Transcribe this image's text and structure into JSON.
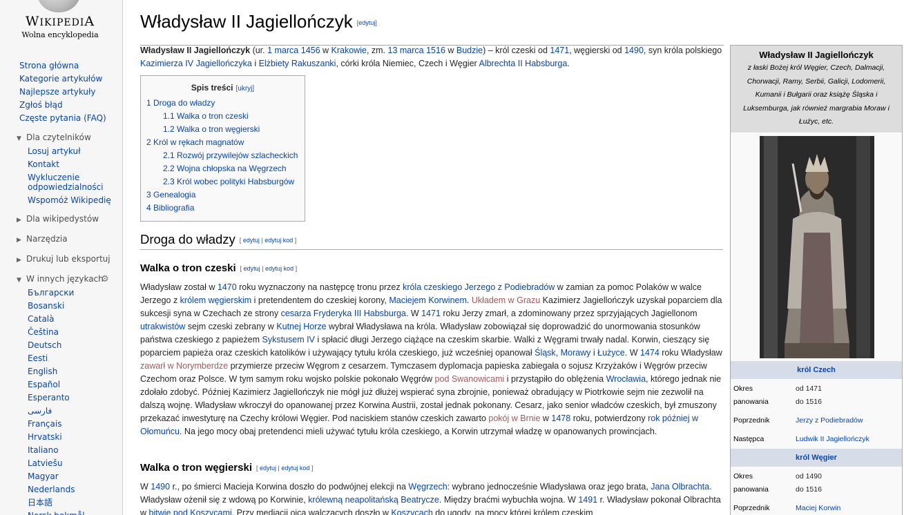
{
  "logo": {
    "wordmark": "Wikipedia",
    "tagline": "Wolna encyklopedia"
  },
  "nav": [
    "Strona główna",
    "Kategorie artykułów",
    "Najlepsze artykuły",
    "Zgłoś błąd",
    "Częste pytania (FAQ)"
  ],
  "portlets": {
    "readers": {
      "heading": "Dla czytelników",
      "items": [
        "Losuj artykuł",
        "Kontakt",
        "Wykluczenie odpowiedzialności",
        "Wspomóż Wikipedię"
      ]
    },
    "editors": {
      "heading": "Dla wikipedystów"
    },
    "tools": {
      "heading": "Narzędzia"
    },
    "print": {
      "heading": "Drukuj lub eksportuj"
    },
    "languages": {
      "heading": "W innych językach",
      "items": [
        "Български",
        "Bosanski",
        "Català",
        "Čeština",
        "Deutsch",
        "Eesti",
        "English",
        "Español",
        "Esperanto",
        "فارسی",
        "Français",
        "Hrvatski",
        "Italiano",
        "Latviešu",
        "Magyar",
        "Nederlands",
        "日本語",
        "Norsk bokmål"
      ]
    }
  },
  "article": {
    "title": "Władysław II Jagiellończyk",
    "edit": "edytuj",
    "edit_source": "edytuj kod",
    "intro": {
      "name": "Władysław II Jagiellończyk",
      "t1": " (ur. ",
      "birth_date": "1 marca 1456",
      "t2": " w ",
      "birth_place": "Krakowie",
      "t3": ", zm. ",
      "death_date": "13 marca 1516",
      "t4": " w ",
      "death_place": "Budzie",
      "t5": ") – król czeski od ",
      "y1": "1471",
      "t6": ", węgierski od ",
      "y2": "1490",
      "t7": ", syn króla polskiego ",
      "father": "Kazimierza IV Jagiellończyka",
      "t8": " i ",
      "mother": "Elżbiety Rakuszanki",
      "t9": ", córki króla Niemiec, Czech i Węgier ",
      "grandfather": "Albrechta II Habsburga",
      "t10": "."
    },
    "toc": {
      "title": "Spis treści",
      "hide": "ukryj",
      "items": [
        "1 Droga do władzy",
        "1.1 Walka o tron czeski",
        "1.2 Walka o tron węgierski",
        "2 Król w rękach magnatów",
        "2.1 Rozwój przywilejów szlacheckich",
        "2.2 Wojna chłopska na Węgrzech",
        "2.3 Król wobec polityki Habsburgów",
        "3 Genealogia",
        "4 Bibliografia"
      ]
    },
    "section1": "Droga do władzy",
    "sub1": "Walka o tron czeski",
    "sub2": "Walka o tron węgierski",
    "p1": [
      "Władysław został w ",
      "1470",
      " roku wyznaczony na następcę tronu przez ",
      "króla czeskiego Jerzego z Podiebradów",
      " w zamian za pomoc Polaków w walce Jerzego z ",
      "królem węgierskim",
      " i pretendentem do czeskiej korony, ",
      "Maciejem Korwinem",
      ". ",
      "Układem w Grazu",
      " Kazimierz Jagiellończyk uzyskał poparciem dla sukcesji syna w Czechach ze strony ",
      "cesarza Fryderyka III Habsburga",
      ". W ",
      "1471",
      " roku Jerzy zmarł, a zdominowany przez sprzyjających Jagiellonom ",
      "utrakwistów",
      " sejm czeski zebrany w ",
      "Kutnej Horze",
      " wybrał Władysława na króla. Władysław zobowiązał się doprowadzić do unormowania stosunków państwa czeskiego z papieżem ",
      "Sykstusem IV",
      " i spłacić długi Jerzego ciążące na czeskim skarbie. Walki z Węgrami trwały nadal. Korwin, cieszący się poparciem papieża oraz czeskich katolików i używający tytułu króla czeskiego, już wcześniej opanował ",
      "Śląsk",
      ", ",
      "Morawy",
      " i ",
      "Łużyce",
      ". W ",
      "1474",
      " roku Władysław ",
      "zawarł w Norymberdze",
      " przymierze przeciw Węgrom z cesarzem. Tymczasem dyplomacja papieska zabiegała o sojusz Krzyżaków i Węgrów przeciw Czechom oraz Polsce. W tym samym roku wojsko polskie pokonało Węgrów ",
      "pod Swanowicami",
      " i przystąpiło do oblężenia ",
      "Wrocławia",
      ", którego jednak nie zdołało zdobyć. Później Kazimierz Jagiellończyk nie mógł już dłużej wspierać syna zbrojnie, ponieważ obradujący w Piotrkowie sejm nie zezwolił na dalszą wojnę. Władysław wkroczył do opanowanej przez Korwina Austrii, został jednak pokonany. Cesarz, jako senior władców czeskich, był zmuszony przekazać inwestyturę na Czechy królowi Węgier. Pod naciskiem stanów czeskich zawarto ",
      "pokój w Brnie",
      " w ",
      "1478",
      " roku, potwierdzony ",
      "rok później w Ołomuńcu",
      ". Na jego mocy obaj pretendenci mieli używać tytułu króla czeskiego, a Korwin utrzymał władzę w opanowanych prowincjach."
    ],
    "p2": [
      "W ",
      "1490",
      " r., po śmierci Macieja Korwina doszło do podwójnej elekcji na ",
      "Węgrzech",
      ": wybrano jednocześnie Władysława oraz jego brata, ",
      "Jana Olbrachta",
      ". Władysław ożenił się z wdową po Korwinie, ",
      "królewną neapolitańską Beatrycze",
      ". Między braćmi wybuchła wojna. W ",
      "1491",
      " r. Władysław pokonał Olbrachta w ",
      "bitwie pod Koszycami",
      ". Przy mediacji ojca walczących doszło w ",
      "Koszycach",
      " do ugody, na mocy której królem czeskim"
    ]
  },
  "infobox": {
    "name": "Władysław II Jagiellończyk",
    "style": "z łaski Bożej król Węgier, Czech, Dalmacji, Chorwacji, Ramy, Serbii, Galicji, Lodomerii, Kumanii i Bułgarii oraz książę Śląska i Luksemburga, jak również margrabia Moraw i Łużyc, etc.",
    "bar1": "król Czech",
    "bar2": "król Węgier",
    "reign_label": "Okres panowania",
    "reign1_from": "od 1471",
    "reign1_to": "do 1516",
    "reign2_from": "od 1490",
    "reign2_to": "do 1516",
    "pred_label": "Poprzednik",
    "pred1": "Jerzy z Podiebradów",
    "succ_label": "Następca",
    "succ1": "Ludwik II Jagiellończyk",
    "pred2": "Maciej Korwin"
  },
  "colors": {
    "link": "#0645ad",
    "redlink": "#a55858",
    "sidebar_bg": "#f6f6f6",
    "infobox_bar": "#d7dde8"
  }
}
